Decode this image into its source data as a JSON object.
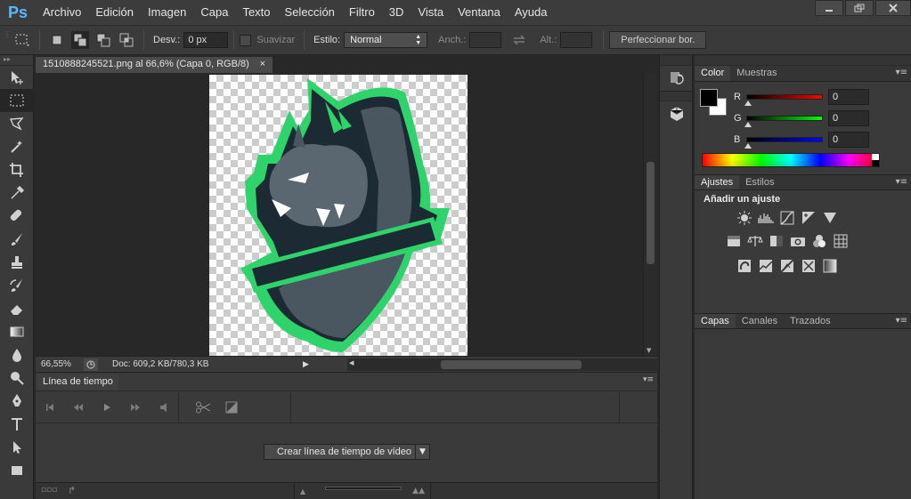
{
  "app": {
    "logo": "Ps"
  },
  "menu": [
    "Archivo",
    "Edición",
    "Imagen",
    "Capa",
    "Texto",
    "Selección",
    "Filtro",
    "3D",
    "Vista",
    "Ventana",
    "Ayuda"
  ],
  "window_controls": [
    "minimize-icon",
    "restore-icon",
    "close-icon"
  ],
  "options": {
    "desvanecer_label": "Desv.:",
    "desvanecer_value": "0 px",
    "suavizar_label": "Suavizar",
    "estilo_label": "Estilo:",
    "estilo_value": "Normal",
    "anchura_label": "Anch.:",
    "altura_label": "Alt.:",
    "refine_button": "Perfeccionar bor."
  },
  "document": {
    "tab_title": "1510888245521.png al 66,6% (Capa 0, RGB/8)",
    "tab_close": "×",
    "zoom": "66,55%",
    "doc_info": "Doc: 609,2 KB/780,3 KB"
  },
  "timeline": {
    "tab": "Línea de tiempo",
    "create_button": "Crear línea de tiempo de vídeo"
  },
  "color_panel": {
    "tabs": [
      "Color",
      "Muestras"
    ],
    "channels": [
      {
        "label": "R",
        "value": "0",
        "color": "#ff0000"
      },
      {
        "label": "G",
        "value": "0",
        "color": "#00ff00"
      },
      {
        "label": "B",
        "value": "0",
        "color": "#0000ff"
      }
    ],
    "foreground": "#000000",
    "background": "#ffffff"
  },
  "adjustments_panel": {
    "tabs": [
      "Ajustes",
      "Estilos"
    ],
    "heading": "Añadir un ajuste"
  },
  "layers_panel": {
    "tabs": [
      "Capas",
      "Canales",
      "Trazados"
    ]
  },
  "colors": {
    "accent_green": "#2ed36b",
    "logo_dark": "#1b2a33",
    "logo_mid": "#4a5760"
  }
}
